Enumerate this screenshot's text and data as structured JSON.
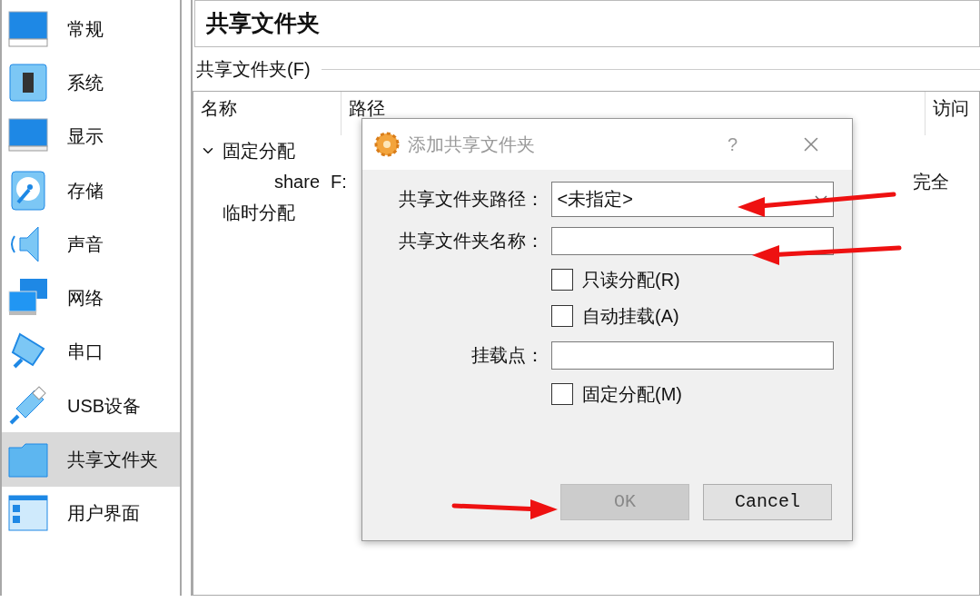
{
  "sidebar": {
    "items": [
      {
        "label": "常规",
        "kind": "monitor",
        "selected": false
      },
      {
        "label": "系统",
        "kind": "chip",
        "selected": false
      },
      {
        "label": "显示",
        "kind": "display",
        "selected": false
      },
      {
        "label": "存储",
        "kind": "disk",
        "selected": false
      },
      {
        "label": "声音",
        "kind": "speaker",
        "selected": false
      },
      {
        "label": "网络",
        "kind": "network",
        "selected": false
      },
      {
        "label": "串口",
        "kind": "serial",
        "selected": false
      },
      {
        "label": "USB设备",
        "kind": "usb",
        "selected": false
      },
      {
        "label": "共享文件夹",
        "kind": "folder",
        "selected": true
      },
      {
        "label": "用户界面",
        "kind": "window",
        "selected": false
      }
    ]
  },
  "page": {
    "title": "共享文件夹",
    "group_label": "共享文件夹(F)"
  },
  "table": {
    "columns": [
      "名称",
      "路径",
      "访问"
    ],
    "rows": [
      {
        "name": "固定分配",
        "expanded": true,
        "children": [
          {
            "name": "share",
            "path": "F:",
            "access": "完全"
          }
        ]
      },
      {
        "name": "临时分配"
      }
    ]
  },
  "dialog": {
    "title": "添加共享文件夹",
    "help": "?",
    "fields": [
      {
        "kind": "select",
        "label": "共享文件夹路径：",
        "value": "<未指定>"
      },
      {
        "kind": "text",
        "label": "共享文件夹名称："
      },
      {
        "kind": "checkbox",
        "label": "只读分配(R)",
        "checked": false
      },
      {
        "kind": "checkbox",
        "label": "自动挂载(A)",
        "checked": false
      },
      {
        "kind": "text",
        "label": "挂载点："
      },
      {
        "kind": "checkbox",
        "label": "固定分配(M)",
        "checked": false
      }
    ],
    "buttons": [
      {
        "label": "OK",
        "disabled": true
      },
      {
        "label": "Cancel",
        "disabled": false
      }
    ]
  }
}
